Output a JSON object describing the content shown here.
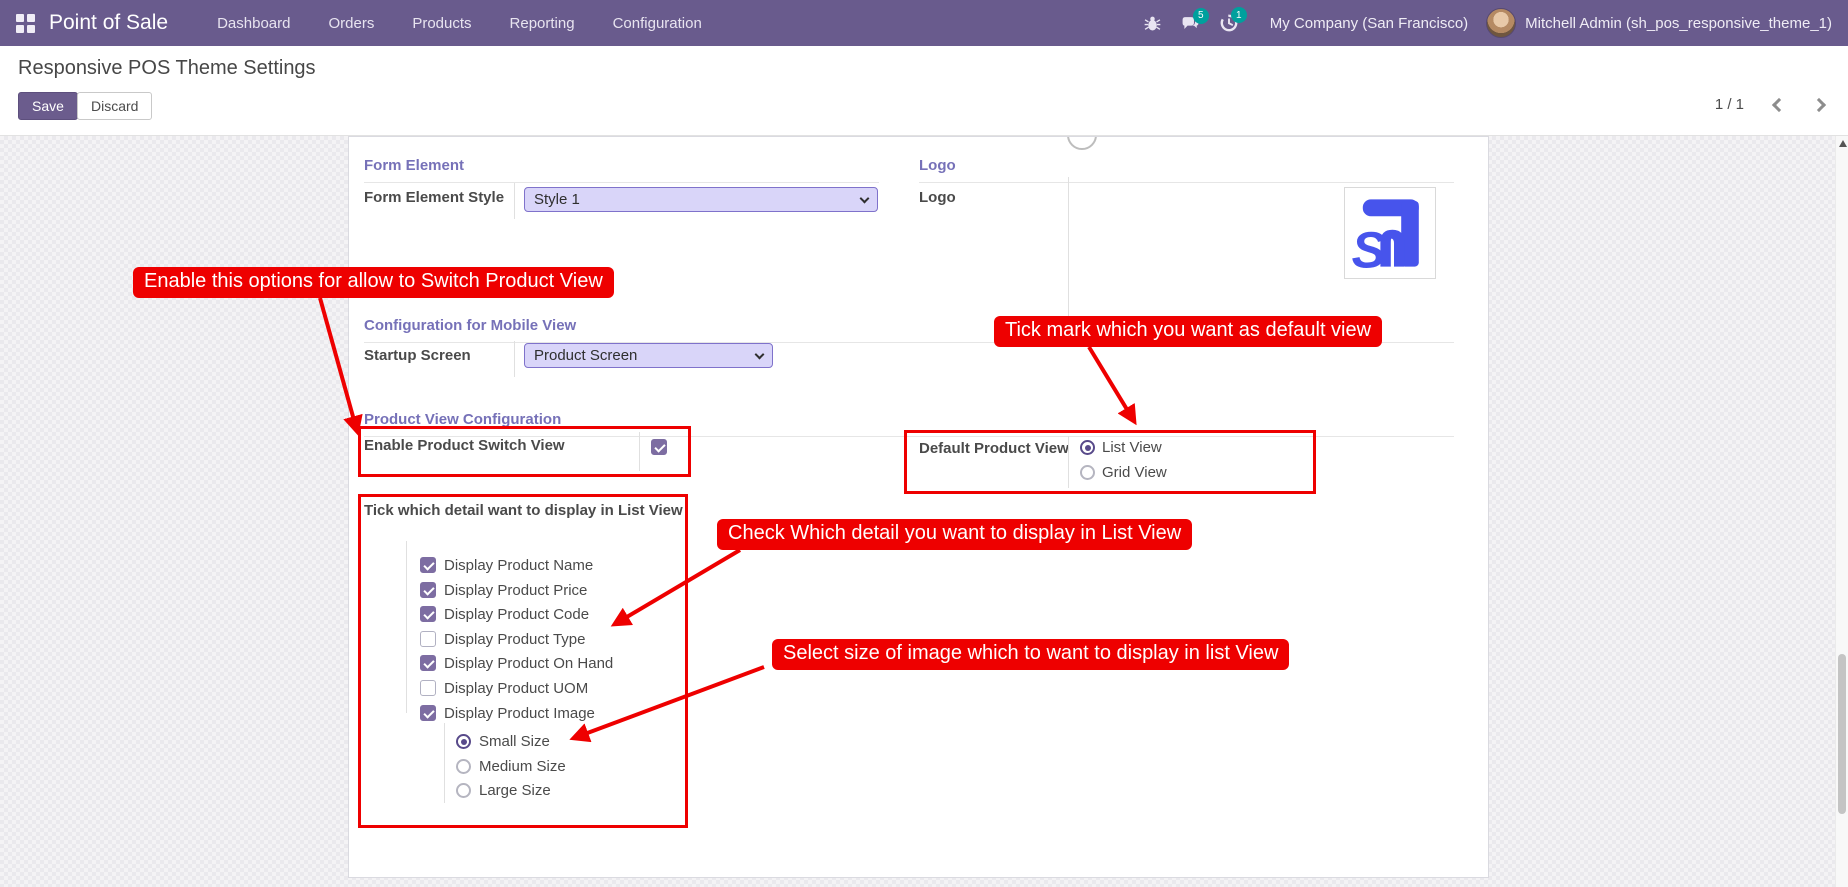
{
  "navbar": {
    "brand": "Point of Sale",
    "menu_items": [
      "Dashboard",
      "Orders",
      "Products",
      "Reporting",
      "Configuration"
    ],
    "messages_badge": "5",
    "activities_badge": "1",
    "company": "My Company (San Francisco)",
    "user": "Mitchell Admin (sh_pos_responsive_theme_1)"
  },
  "control_panel": {
    "title": "Responsive POS Theme Settings",
    "save_label": "Save",
    "discard_label": "Discard",
    "pager": "1 / 1"
  },
  "form": {
    "form_element": {
      "header": "Form Element",
      "style_label": "Form Element Style",
      "style_value": "Style 1"
    },
    "logo": {
      "header": "Logo",
      "label": "Logo"
    },
    "mobile_config": {
      "header": "Configuration for Mobile View",
      "startup_label": "Startup Screen",
      "startup_value": "Product Screen"
    },
    "product_view": {
      "header": "Product View Configuration",
      "enable_label": "Enable Product Switch View",
      "enable_checked": true,
      "default_label": "Default Product View",
      "default_options": [
        {
          "label": "List View",
          "selected": true
        },
        {
          "label": "Grid View",
          "selected": false
        }
      ],
      "list_title": "Tick which detail want to display in List View",
      "list_items": [
        {
          "label": "Display Product Name",
          "checked": true
        },
        {
          "label": "Display Product Price",
          "checked": true
        },
        {
          "label": "Display Product Code",
          "checked": true
        },
        {
          "label": "Display Product Type",
          "checked": false
        },
        {
          "label": "Display Product On Hand",
          "checked": true
        },
        {
          "label": "Display Product UOM",
          "checked": false
        },
        {
          "label": "Display Product Image",
          "checked": true
        }
      ],
      "image_sizes": [
        {
          "label": "Small Size",
          "selected": true
        },
        {
          "label": "Medium Size",
          "selected": false
        },
        {
          "label": "Large Size",
          "selected": false
        }
      ]
    }
  },
  "annotations": {
    "callout_switch_view": "Enable this options for allow to Switch Product View",
    "callout_default_view": "Tick mark which you want as default view",
    "callout_list_detail": "Check Which detail you want to display in List View",
    "callout_image_size": "Select size of image which to want to display in list View",
    "annotation_color": "#ee0000"
  },
  "colors": {
    "navbar_bg": "#695b8d",
    "accent": "#6b5c8d",
    "section_header": "#7671b8",
    "badge": "#00a09d",
    "field_bg": "#d9d5f9",
    "logo_blue": "#4754ec"
  }
}
